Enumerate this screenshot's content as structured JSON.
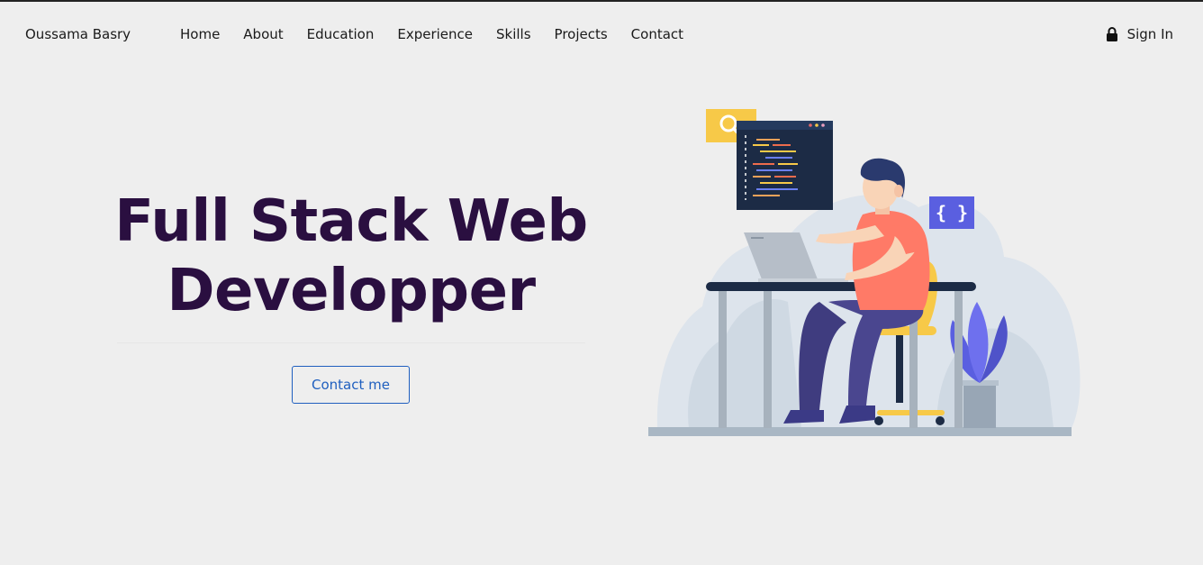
{
  "nav": {
    "brand": "Oussama Basry",
    "links": [
      "Home",
      "About",
      "Education",
      "Experience",
      "Skills",
      "Projects",
      "Contact"
    ],
    "signin_label": "Sign In",
    "signin_icon": "lock-icon"
  },
  "hero": {
    "title_line1": "Full Stack Web",
    "title_line2": "Developper",
    "button_label": "Contact me",
    "code_badge": "{ }"
  },
  "colors": {
    "background": "#eeeeee",
    "title": "#2a0f40",
    "button": "#1f5fbf"
  }
}
